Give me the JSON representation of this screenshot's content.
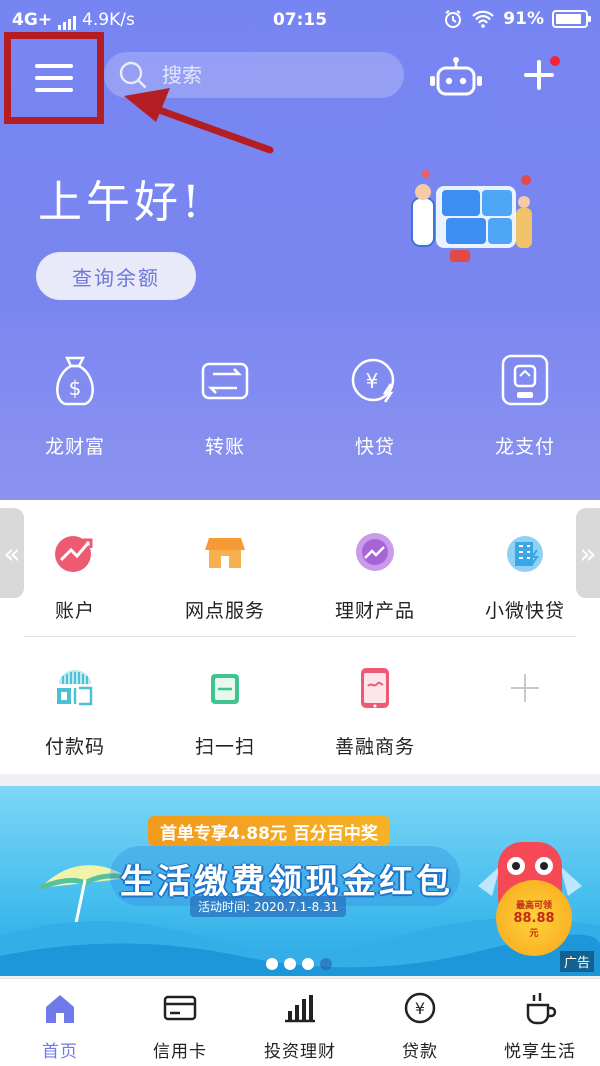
{
  "status_bar": {
    "network": "4G+",
    "speed": "4.9K/s",
    "time": "07:15",
    "battery": "91%",
    "battery_level": 0.91
  },
  "search": {
    "placeholder": "搜索"
  },
  "greeting": "上午好!",
  "balance_button": "查询余额",
  "quick_actions": [
    {
      "label": "龙财富",
      "icon": "money-bag-icon"
    },
    {
      "label": "转账",
      "icon": "transfer-icon"
    },
    {
      "label": "快贷",
      "icon": "loan-icon"
    },
    {
      "label": "龙支付",
      "icon": "pay-icon"
    }
  ],
  "services_row1": [
    {
      "label": "账户",
      "icon": "account-icon"
    },
    {
      "label": "网点服务",
      "icon": "branch-icon"
    },
    {
      "label": "理财产品",
      "icon": "wealth-icon"
    },
    {
      "label": "小微快贷",
      "icon": "micro-loan-icon"
    }
  ],
  "services_row2": [
    {
      "label": "付款码",
      "icon": "payment-code-icon"
    },
    {
      "label": "扫一扫",
      "icon": "scan-icon"
    },
    {
      "label": "善融商务",
      "icon": "ecommerce-icon"
    }
  ],
  "banner": {
    "top_text": "首单专享4.88元 百分百中奖",
    "title": "生活缴费领现金红包",
    "date": "活动时间: 2020.7.1-8.31",
    "badge_line1": "最高可领",
    "badge_amount": "88.88",
    "badge_unit": "元",
    "ad_label": "广告"
  },
  "tab_bar": [
    {
      "label": "首页",
      "icon": "home-icon",
      "active": true
    },
    {
      "label": "信用卡",
      "icon": "credit-card-icon"
    },
    {
      "label": "投资理财",
      "icon": "chart-icon"
    },
    {
      "label": "贷款",
      "icon": "yen-icon"
    },
    {
      "label": "悦享生活",
      "icon": "coffee-icon"
    }
  ],
  "colors": {
    "hero": "#7785f2",
    "accent": "#6f7ae8",
    "highlight_box": "#b41d22"
  }
}
